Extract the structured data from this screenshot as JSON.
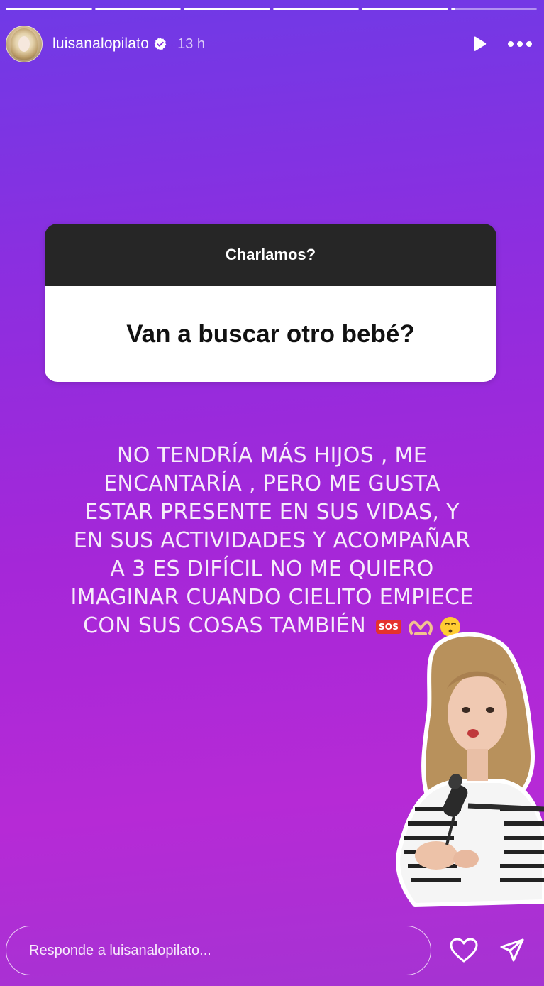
{
  "progress": {
    "segments": [
      1,
      1,
      1,
      1,
      1,
      0.05
    ]
  },
  "header": {
    "username": "luisanalopilato",
    "time": "13 h",
    "verified_icon": "verified-badge-icon",
    "play_icon": "play-icon",
    "more_icon": "more-dots-icon"
  },
  "question": {
    "title": "Charlamos?",
    "text": "Van a buscar otro bebé?"
  },
  "answer": {
    "lines": [
      "NO TENDRÍA MÁS HIJOS , ME",
      "ENCANTARÍA , PERO ME GUSTA",
      "ESTAR PRESENTE EN SUS VIDAS, Y",
      "EN SUS ACTIVIDADES Y ACOMPAÑAR",
      "A 3 ES DIFÍCIL NO ME QUIERO",
      "IMAGINAR CUANDO CIELITO EMPIECE",
      "CON SUS COSAS TAMBIÉN"
    ],
    "sos_emoji": "SOS"
  },
  "footer": {
    "reply_placeholder": "Responde a luisanalopilato...",
    "like_icon": "heart-icon",
    "share_icon": "send-icon"
  },
  "colors": {
    "card_header": "#262626",
    "card_body": "#ffffff",
    "sos_red": "#e5322d"
  }
}
